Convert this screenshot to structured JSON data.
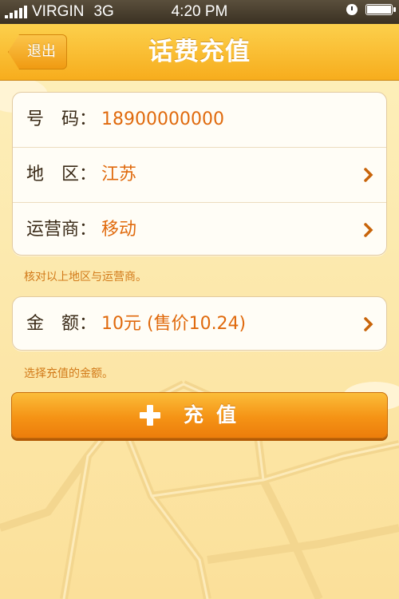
{
  "status_bar": {
    "carrier": "VIRGIN",
    "network": "3G",
    "time": "4:20 PM"
  },
  "navbar": {
    "back_label": "退出",
    "title": "话费充值"
  },
  "info_card": {
    "phone": {
      "label": "号　码：",
      "value": "18900000000"
    },
    "region": {
      "label": "地　区：",
      "value": "江苏"
    },
    "operator": {
      "label": "运营商：",
      "value": "移动"
    }
  },
  "info_hint": "核对以上地区与运营商。",
  "amount_card": {
    "label": "金　额：",
    "value": "10元 (售价10.24)"
  },
  "amount_hint": "选择充值的金额。",
  "charge_button": {
    "label": "充值"
  },
  "colors": {
    "accent": "#f59315",
    "value_text": "#e06a0d",
    "nav": "#f7ad1d"
  }
}
